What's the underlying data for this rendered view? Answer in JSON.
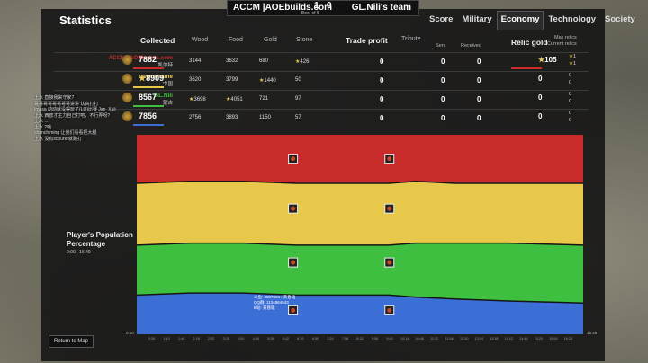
{
  "title": "Statistics",
  "scorebar": {
    "left_team": "ACCM |AOEbuilds.com",
    "right_team": "GL.Nili's team",
    "score_left": "1",
    "score_right": "0",
    "best_of": "Best of 5"
  },
  "tabs": [
    {
      "label": "Score",
      "active": false
    },
    {
      "label": "Military",
      "active": false
    },
    {
      "label": "Economy",
      "active": true
    },
    {
      "label": "Technology",
      "active": false
    },
    {
      "label": "Society",
      "active": false
    }
  ],
  "headers": {
    "collected": "Collected",
    "wood": "Wood",
    "food": "Food",
    "gold": "Gold",
    "stone": "Stone",
    "trade_profit": "Trade profit",
    "tribute": "Tribute",
    "sent": "Sent",
    "received": "Received",
    "relic_gold": "Relic gold",
    "max_relics": "Max relics",
    "current_relics": "Current relics"
  },
  "players": [
    {
      "name": "ACCM_AOEbuilds.com",
      "civ": "凯尔特",
      "color": "#c92a2a",
      "collected": "7882",
      "wood": "3144",
      "food": "3632",
      "gold": "680",
      "stone": "426",
      "stone_star": true,
      "trade": "0",
      "sent": "0",
      "received": "0",
      "relic_gold": "105",
      "max_relics": "1",
      "current_relics": "1",
      "relic_stars": true
    },
    {
      "name": "saymyname",
      "civ": "中国",
      "color": "#e8c84a",
      "collected": "8909",
      "collected_star": true,
      "wood": "3620",
      "food": "3799",
      "gold": "1440",
      "gold_star": true,
      "stone": "50",
      "trade": "0",
      "sent": "0",
      "received": "0",
      "relic_gold": "0",
      "max_relics": "0",
      "current_relics": "0"
    },
    {
      "name": "GL.Nili",
      "civ": "蒙古",
      "color": "#3fbf3f",
      "collected": "8567",
      "wood": "3698",
      "wood_star": true,
      "food": "4051",
      "food_star": true,
      "gold": "721",
      "stone": "97",
      "trade": "0",
      "sent": "0",
      "received": "0",
      "relic_gold": "0",
      "max_relics": "0",
      "current_relics": "0"
    },
    {
      "name": "",
      "civ": "",
      "color": "#3c6fd6",
      "collected": "7856",
      "wood": "2756",
      "food": "3893",
      "gold": "1150",
      "stone": "57",
      "trade": "0",
      "sent": "0",
      "received": "0",
      "relic_gold": "0",
      "max_relics": "0",
      "current_relics": "0"
    }
  ],
  "chat": [
    "上水    直接我来守家?",
    "哥哥哥哥哥哥哥哥讲讲    认真打打",
    "Imasa    动动就没得玩了(LQ)比赛    Jan_Xuli",
    "上水    西欧才主力自己打吧，不行弄呀?",
    "上水    ...",
    "上水    2哦",
    "chanchiming    让我们看看把大腿",
    "上水    没有scourer就跑打"
  ],
  "chart": {
    "label": "Player's Population Percentage",
    "time_range": "0:00 - 16:49",
    "axis_start": "0:00",
    "axis_end": "16:49",
    "ticks": [
      "0:36",
      "1:10",
      "1:44",
      "2:18",
      "2:52",
      "3:26",
      "4:00",
      "4:34",
      "5:08",
      "5:42",
      "6:16",
      "6:50",
      "7:24",
      "7:58",
      "8:32",
      "9:06",
      "9:40",
      "10:14",
      "10:48",
      "11:22",
      "11:56",
      "12:30",
      "13:04",
      "13:38",
      "14:12",
      "14:46",
      "15:20",
      "15:54",
      "16:28"
    ],
    "overlay_lines": [
      "斗鱼: 8807659 / 黄昏雄",
      "QQ群: 1134864943",
      "B站: 黄昏雄"
    ]
  },
  "chart_data": {
    "type": "area",
    "title": "Player's Population Percentage",
    "xlabel": "",
    "ylabel": "",
    "x": [
      "0:00",
      "2:00",
      "4:00",
      "6:00",
      "8:00",
      "9:30",
      "10:30",
      "12:00",
      "14:00",
      "16:49"
    ],
    "ylim": [
      0,
      100
    ],
    "series": [
      {
        "name": "",
        "color": "#3c6fd6",
        "values": [
          20,
          21,
          21,
          20,
          20,
          20,
          19,
          18,
          17,
          16
        ]
      },
      {
        "name": "",
        "color": "#3fbf3f",
        "values": [
          25,
          25,
          25,
          25,
          25,
          25,
          27,
          28,
          29,
          29
        ]
      },
      {
        "name": "",
        "color": "#e8c84a",
        "values": [
          31,
          31,
          31,
          31,
          31,
          31,
          31,
          30,
          30,
          31
        ]
      },
      {
        "name": "",
        "color": "#c92a2a",
        "values": [
          24,
          23,
          23,
          24,
          24,
          24,
          23,
          24,
          24,
          24
        ]
      }
    ]
  },
  "buttons": {
    "return": "Return to Map"
  }
}
